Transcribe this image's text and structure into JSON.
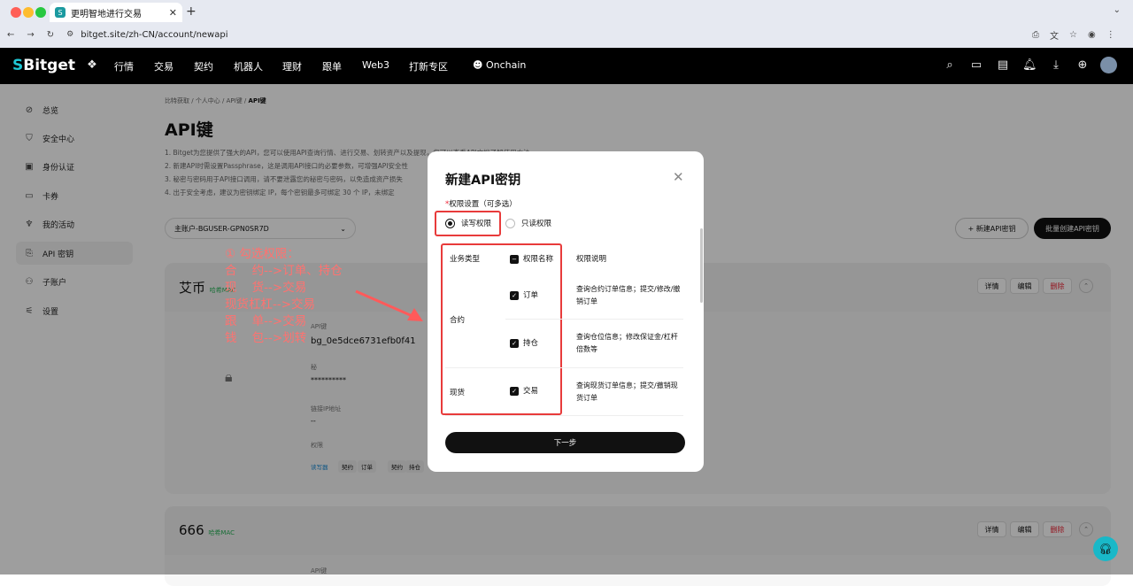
{
  "browser": {
    "tab_title": "更明智地进行交易",
    "url": "bitget.site/zh-CN/account/newapi"
  },
  "topnav": {
    "logo": "Bitget",
    "items": [
      "行情",
      "交易",
      "契约",
      "机器人",
      "理财",
      "跟单",
      "Web3",
      "打新专区"
    ],
    "onchain": "Onchain"
  },
  "sidebar": {
    "items": [
      {
        "label": "总览",
        "icon": "compass-icon"
      },
      {
        "label": "安全中心",
        "icon": "shield-icon"
      },
      {
        "label": "身份认证",
        "icon": "id-card-icon"
      },
      {
        "label": "卡券",
        "icon": "ticket-icon"
      },
      {
        "label": "我的活动",
        "icon": "trophy-icon"
      },
      {
        "label": "API 密钥",
        "icon": "key-icon"
      },
      {
        "label": "子账户",
        "icon": "users-icon"
      },
      {
        "label": "设置",
        "icon": "sliders-icon"
      }
    ]
  },
  "page": {
    "breadcrumb": [
      "比特获取",
      "个人中心",
      "API键",
      "API键"
    ],
    "title": "API键",
    "notes": [
      "1. Bitget为您提供了强大的API，您可以使用API查询行情、进行交易、划转资产以及提现，您可以查看API文档了解使用方法",
      "2. 新建API时需设置Passphrase，这是调用API接口的必要参数，可增强API安全性",
      "3. 秘密与密码用于API接口调用，请不要泄露您的秘密与密码，以免造成资产损失",
      "4. 出于安全考虑，建议为密钥绑定 IP，每个密钥最多可绑定 30 个 IP，未绑定"
    ],
    "account_select": "主账户-BGUSER-GPN0SR7D",
    "new_key_button": "新建API密钥",
    "batch_button": "批量创建API密钥"
  },
  "cards": [
    {
      "name": "艾币",
      "tag": "哈希MAC",
      "actions": [
        "详情",
        "编辑",
        "删除"
      ],
      "api_label": "API键",
      "api_value": "bg_0e5dce6731efb0f41",
      "secret_label": "秘",
      "secret_value": "**********",
      "ip_label": "链接IP地址",
      "ip_value": "--",
      "perm_label": "权限",
      "perms": [
        "读写器",
        "契约",
        "订单",
        "契约",
        "持仓"
      ]
    },
    {
      "name": "666",
      "tag": "哈希MAC",
      "actions": [
        "详情",
        "编辑",
        "删除"
      ],
      "api_label": "API键"
    }
  ],
  "annotation": "① 勾选权限：\n合    约-->订单、持仓\n现    货-->交易\n现货杠杠-->交易\n跟    单-->交易\n钱    包-->划转",
  "dialog": {
    "title": "新建API密钥",
    "section_label": "权限设置（可多选）",
    "required_mark": "*",
    "radio_rw": "读写权限",
    "radio_ro": "只读权限",
    "col_type": "业务类型",
    "col_name": "权限名称",
    "col_desc": "权限说明",
    "rows": [
      {
        "type": "合约",
        "name": "订单",
        "desc": "查询合约订单信息；提交/修改/撤销订单"
      },
      {
        "name": "持仓",
        "desc": "查询仓位信息；修改保证金/杠杆倍数等"
      },
      {
        "type": "现货",
        "name": "交易",
        "desc": "查询现货订单信息；提交/撤销现货订单"
      }
    ],
    "next_button": "下一步"
  },
  "colors": {
    "annotation": "#ff7270",
    "redbox": "#e83b3b",
    "support": "#19b8c8"
  }
}
